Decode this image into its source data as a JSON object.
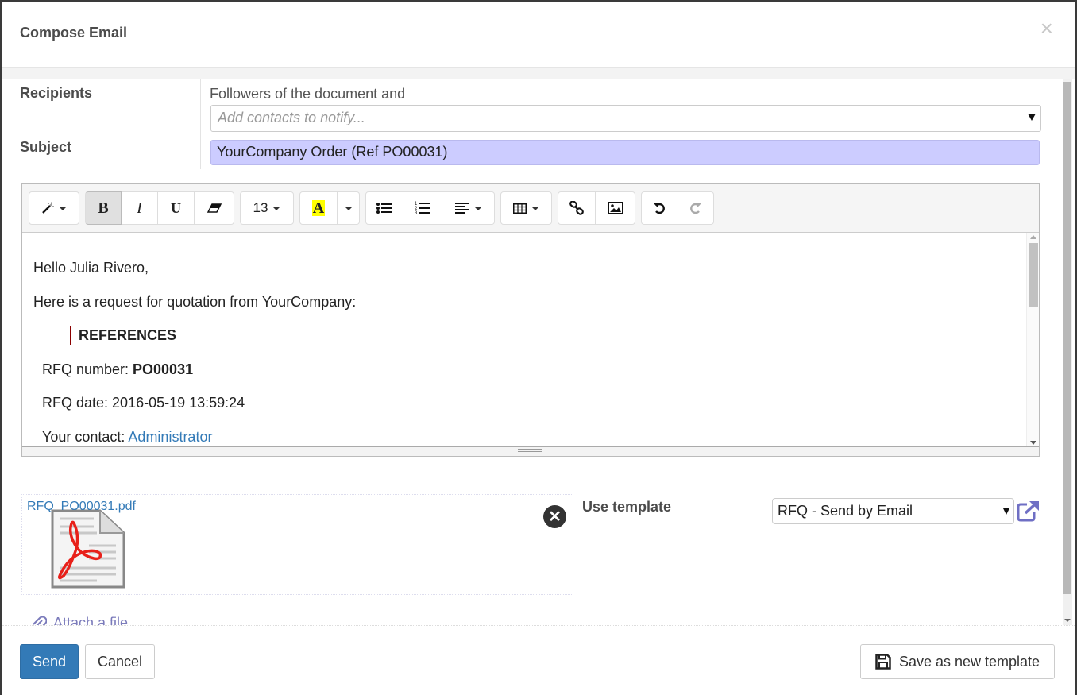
{
  "dialog": {
    "title": "Compose Email",
    "close_icon": "close-icon"
  },
  "recipients": {
    "label": "Recipients",
    "followers_text": "Followers of the document and",
    "contacts_placeholder": "Add contacts to notify..."
  },
  "subject": {
    "label": "Subject",
    "value": "YourCompany Order (Ref PO00031)"
  },
  "toolbar": {
    "style_icon": "magic-wand-icon",
    "bold": "B",
    "italic": "I",
    "underline": "U",
    "eraser_icon": "eraser-icon",
    "font_size": "13",
    "color_letter": "A",
    "highlight_color": "#ffff00",
    "unordered_list_icon": "bullet-list-icon",
    "ordered_list_icon": "numbered-list-icon",
    "align_icon": "align-left-icon",
    "table_icon": "table-icon",
    "link_icon": "link-icon",
    "image_icon": "image-icon",
    "undo_icon": "undo-icon",
    "redo_icon": "redo-icon"
  },
  "body": {
    "greeting": "Hello Julia Rivero,",
    "intro": "Here is a request for quotation from YourCompany:",
    "references_heading": "REFERENCES",
    "rfq_number_label": "RFQ number: ",
    "rfq_number_value": "PO00031",
    "rfq_date": "RFQ date: 2016-05-19 13:59:24",
    "contact_label": "Your contact: ",
    "contact_value": "Administrator"
  },
  "attachment": {
    "filename": "RFQ_PO00031.pdf",
    "file_icon": "pdf-file-icon",
    "remove_icon": "remove-circle-icon",
    "attach_label": "Attach a file"
  },
  "template": {
    "label": "Use template",
    "selected": "RFQ - Send by Email",
    "external_link_icon": "external-link-icon"
  },
  "footer": {
    "send": "Send",
    "cancel": "Cancel",
    "save_template": "Save as new template"
  },
  "colors": {
    "primary": "#337ab7",
    "subject_bg": "#ccccff",
    "link": "#337ab7"
  }
}
